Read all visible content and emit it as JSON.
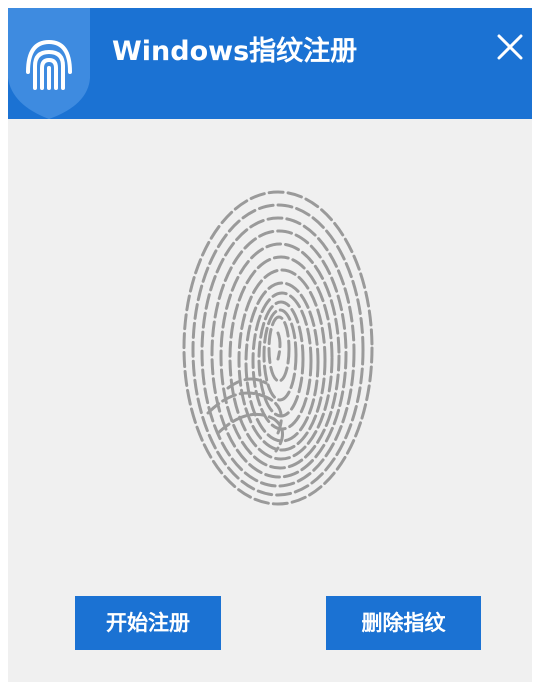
{
  "window": {
    "title": "Windows指纹注册",
    "close_icon": "close-icon",
    "app_icon": "shield-fingerprint-icon"
  },
  "main": {
    "illustration_icon": "fingerprint-icon"
  },
  "buttons": {
    "start_label": "开始注册",
    "delete_label": "删除指纹"
  },
  "colors": {
    "accent": "#1b72d3",
    "background": "#f0f0f0",
    "fingerprint": "#9a9a9a"
  }
}
